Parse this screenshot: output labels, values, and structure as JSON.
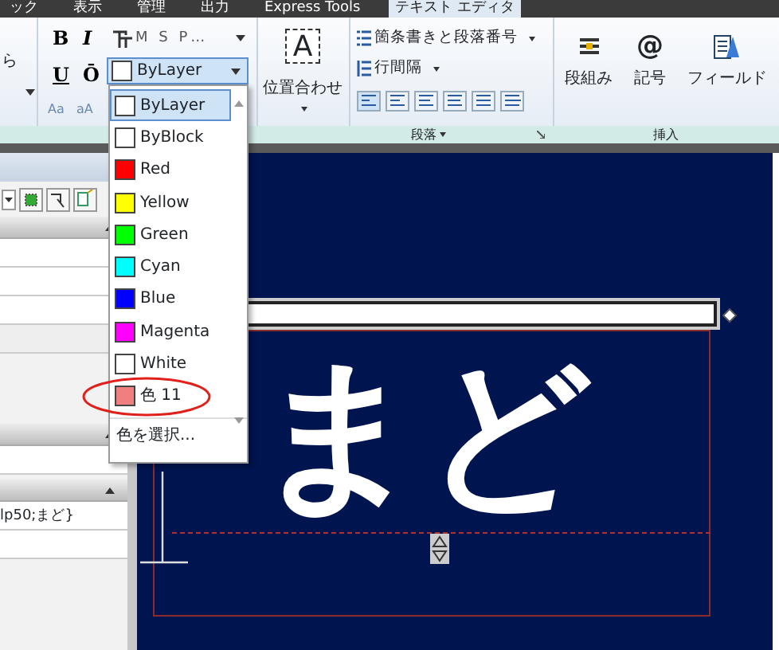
{
  "menu_tabs": [
    {
      "label": "ック",
      "selected": false
    },
    {
      "label": "表示",
      "selected": false
    },
    {
      "label": "管理",
      "selected": false
    },
    {
      "label": "出力",
      "selected": false
    },
    {
      "label": "Express Tools",
      "selected": false
    },
    {
      "label": "テキスト エディタ",
      "selected": true
    }
  ],
  "ribbon": {
    "left_group_text": "ら",
    "format": {
      "bold": "B",
      "italic": "I",
      "font": "M S P…",
      "underline": "U",
      "overline": "Ō",
      "upper": "Aa",
      "lower": "aA",
      "color_combo": "ByLayer"
    },
    "justify_icon": "A",
    "justify_button": "位置合わせ",
    "paragraph": {
      "bullets": "箇条書きと段落番号",
      "line_spacing": "行間隔",
      "label": "段落"
    },
    "insert": {
      "buttons": [
        {
          "kind": "columns",
          "label": "段組み"
        },
        {
          "kind": "symbol",
          "icon": "@",
          "label": "記号"
        },
        {
          "kind": "field",
          "label": "フィールド"
        }
      ],
      "label": "挿入"
    }
  },
  "color_list": {
    "items": [
      {
        "label": "ByLayer",
        "color": "#ffffff",
        "selected": true,
        "circled": false
      },
      {
        "label": "ByBlock",
        "color": "#ffffff",
        "selected": false,
        "circled": false
      },
      {
        "label": "Red",
        "color": "#ff0000",
        "selected": false,
        "circled": false
      },
      {
        "label": "Yellow",
        "color": "#ffff00",
        "selected": false,
        "circled": false
      },
      {
        "label": "Green",
        "color": "#00ff00",
        "selected": false,
        "circled": false
      },
      {
        "label": "Cyan",
        "color": "#00ffff",
        "selected": false,
        "circled": false
      },
      {
        "label": "Blue",
        "color": "#0000ff",
        "selected": false,
        "circled": false
      },
      {
        "label": "Magenta",
        "color": "#ff00ff",
        "selected": false,
        "circled": false
      },
      {
        "label": "White",
        "color": "#ffffff",
        "selected": false,
        "circled": false
      },
      {
        "label": "色 11",
        "color": "#f08080",
        "selected": false,
        "circled": true
      }
    ],
    "more": "色を選択..."
  },
  "properties_panel": {
    "content_value": "lp50;まど}"
  },
  "canvas": {
    "text": "まど"
  }
}
